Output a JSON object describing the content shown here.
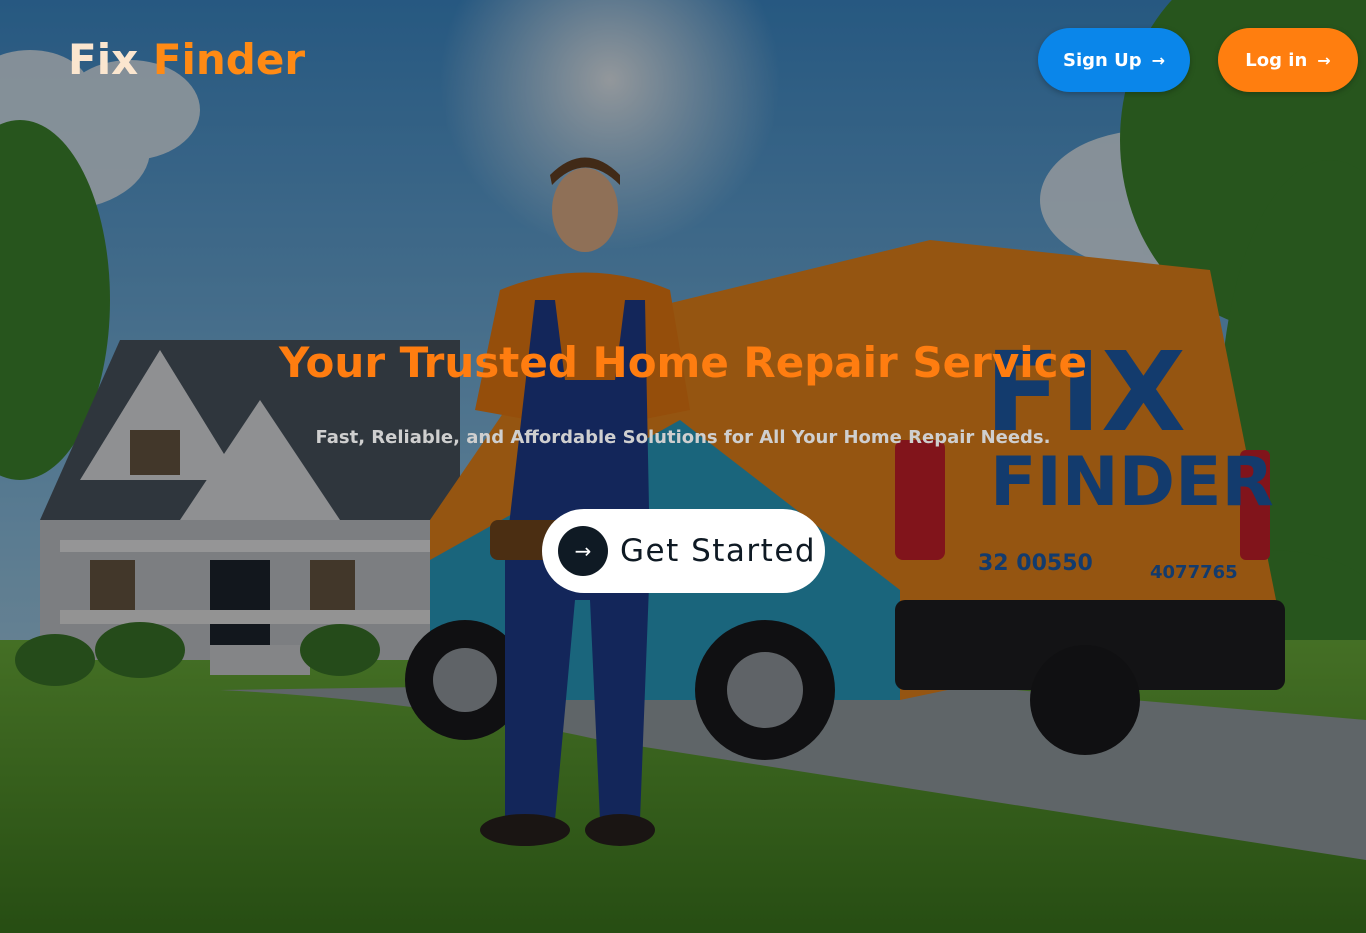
{
  "brand": {
    "word1": "Fix",
    "word2": "Finder",
    "color1": "#fbe6cf",
    "color2": "#ff8a14"
  },
  "nav": {
    "signup_label": "Sign Up",
    "login_label": "Log in",
    "signup_color": "#0a86ea",
    "login_color": "#ff7e0f",
    "arrow_icon": "arrow-right-icon",
    "arrow_glyph": "→"
  },
  "hero": {
    "headline": "Your Trusted Home Repair Service",
    "subheadline": "Fast, Reliable, and Affordable Solutions for All Your Home Repair Needs.",
    "cta_label": "Get Started",
    "cta_icon": "arrow-right-icon",
    "cta_glyph": "→",
    "accent_color": "#ff7d10",
    "van_brand_line1": "FIX",
    "van_brand_line2": "FINDER",
    "van_plate": "32",
    "van_number": "00550",
    "van_phone": "4077765"
  }
}
